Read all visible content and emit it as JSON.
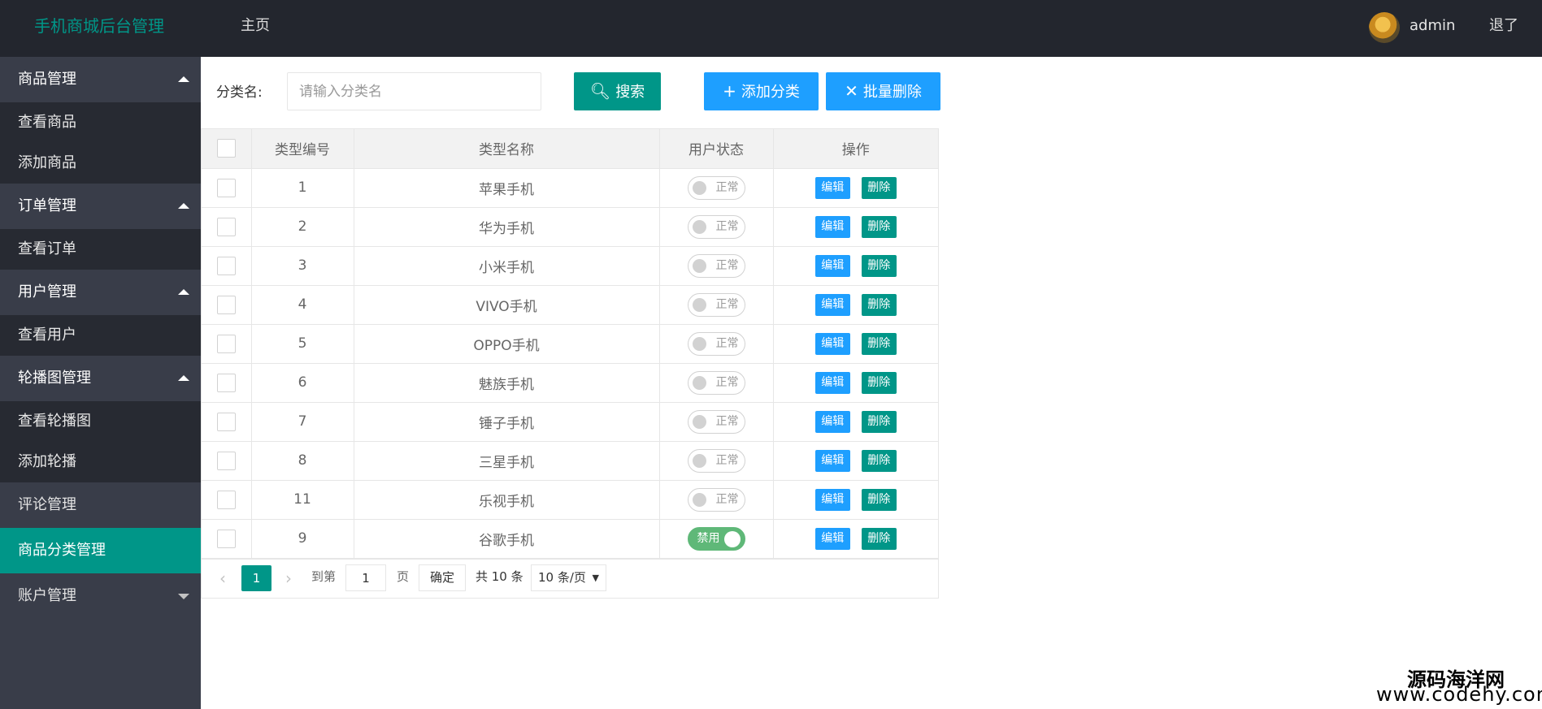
{
  "header": {
    "brand": "手机商城后台管理",
    "home": "主页",
    "user": "admin",
    "logout": "退了"
  },
  "sidebar": {
    "groups": [
      {
        "label": "商品管理",
        "children": [
          "查看商品",
          "添加商品"
        ]
      },
      {
        "label": "订单管理",
        "children": [
          "查看订单"
        ]
      },
      {
        "label": "用户管理",
        "children": [
          "查看用户"
        ]
      },
      {
        "label": "轮播图管理",
        "children": [
          "查看轮播图",
          "添加轮播"
        ]
      },
      {
        "label": "评论管理"
      },
      {
        "label": "商品分类管理",
        "active": true
      },
      {
        "label": "账户管理"
      }
    ]
  },
  "search": {
    "label": "分类名:",
    "placeholder": "请输入分类名",
    "search_btn": "搜索",
    "add_btn": "添加分类",
    "batch_delete_btn": "批量删除"
  },
  "table": {
    "headers": [
      "类型编号",
      "类型名称",
      "用户状态",
      "操作"
    ],
    "rows": [
      {
        "id": "1",
        "name": "苹果手机",
        "status": "正常",
        "on": false
      },
      {
        "id": "2",
        "name": "华为手机",
        "status": "正常",
        "on": false
      },
      {
        "id": "3",
        "name": "小米手机",
        "status": "正常",
        "on": false
      },
      {
        "id": "4",
        "name": "VIVO手机",
        "status": "正常",
        "on": false
      },
      {
        "id": "5",
        "name": "OPPO手机",
        "status": "正常",
        "on": false
      },
      {
        "id": "6",
        "name": "魅族手机",
        "status": "正常",
        "on": false
      },
      {
        "id": "7",
        "name": "锤子手机",
        "status": "正常",
        "on": false
      },
      {
        "id": "8",
        "name": "三星手机",
        "status": "正常",
        "on": false
      },
      {
        "id": "11",
        "name": "乐视手机",
        "status": "正常",
        "on": false
      },
      {
        "id": "9",
        "name": "谷歌手机",
        "status": "禁用",
        "on": true
      }
    ],
    "edit_label": "编辑",
    "delete_label": "删除"
  },
  "pager": {
    "current_page": "1",
    "goto_label": "到第",
    "page_input": "1",
    "page_unit": "页",
    "confirm": "确定",
    "total": "共 10 条",
    "page_size": "10 条/页"
  },
  "watermark": {
    "cn": "源码海洋网",
    "en": "www.codehy.com"
  },
  "colors": {
    "header_bg": "#23262e",
    "sidebar_bg": "#393d49",
    "sidebar_child_bg": "#272a32",
    "accent": "#009688",
    "primary_blue": "#1e9fff",
    "switch_on": "#5fb878"
  }
}
